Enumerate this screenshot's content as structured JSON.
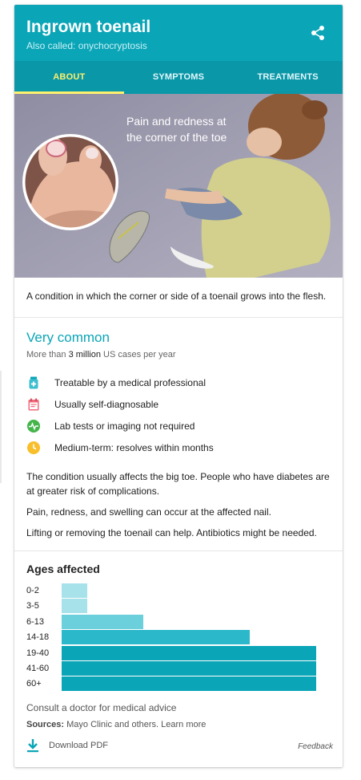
{
  "header": {
    "title": "Ingrown toenail",
    "subtitle": "Also called: onychocryptosis"
  },
  "tabs": [
    {
      "label": "ABOUT",
      "active": true
    },
    {
      "label": "SYMPTOMS",
      "active": false
    },
    {
      "label": "TREATMENTS",
      "active": false
    }
  ],
  "illustration": {
    "caption": "Pain and redness at the corner of the toe"
  },
  "description": "A condition in which the corner or side of a toenail grows into the flesh.",
  "prevalence": {
    "title": "Very common",
    "sub_prefix": "More than ",
    "sub_value": "3 million",
    "sub_suffix": " US cases per year"
  },
  "facts": [
    {
      "icon": "medicine-bottle-icon",
      "text": "Treatable by a medical professional"
    },
    {
      "icon": "calendar-icon",
      "text": "Usually self-diagnosable"
    },
    {
      "icon": "pulse-icon",
      "text": "Lab tests or imaging not required"
    },
    {
      "icon": "clock-icon",
      "text": "Medium-term: resolves within months"
    }
  ],
  "paragraphs": [
    "The condition usually affects the big toe. People who have diabetes are at greater risk of complications.",
    "Pain, redness, and swelling can occur at the affected nail.",
    "Lifting or removing the toenail can help. Antibiotics might be needed."
  ],
  "ages": {
    "title": "Ages affected"
  },
  "chart_data": {
    "type": "bar",
    "orientation": "horizontal",
    "categories": [
      "0-2",
      "3-5",
      "6-13",
      "14-18",
      "19-40",
      "41-60",
      "60+"
    ],
    "values": [
      0.1,
      0.1,
      0.32,
      0.74,
      1.0,
      1.0,
      1.0
    ],
    "colors": [
      "#a7e1ea",
      "#a7e1ea",
      "#6ccfdc",
      "#2bb8ca",
      "#0aa5b7",
      "#0aa5b7",
      "#0aa5b7"
    ]
  },
  "footer": {
    "consult": "Consult a doctor for medical advice",
    "sources_label": "Sources:",
    "sources_text": " Mayo Clinic and others. Learn more",
    "download": "Download PDF",
    "feedback": "Feedback"
  },
  "colors": {
    "brand": "#0aa5b7",
    "tab_bar": "#0a97a8",
    "tab_active": "#fff06d"
  }
}
